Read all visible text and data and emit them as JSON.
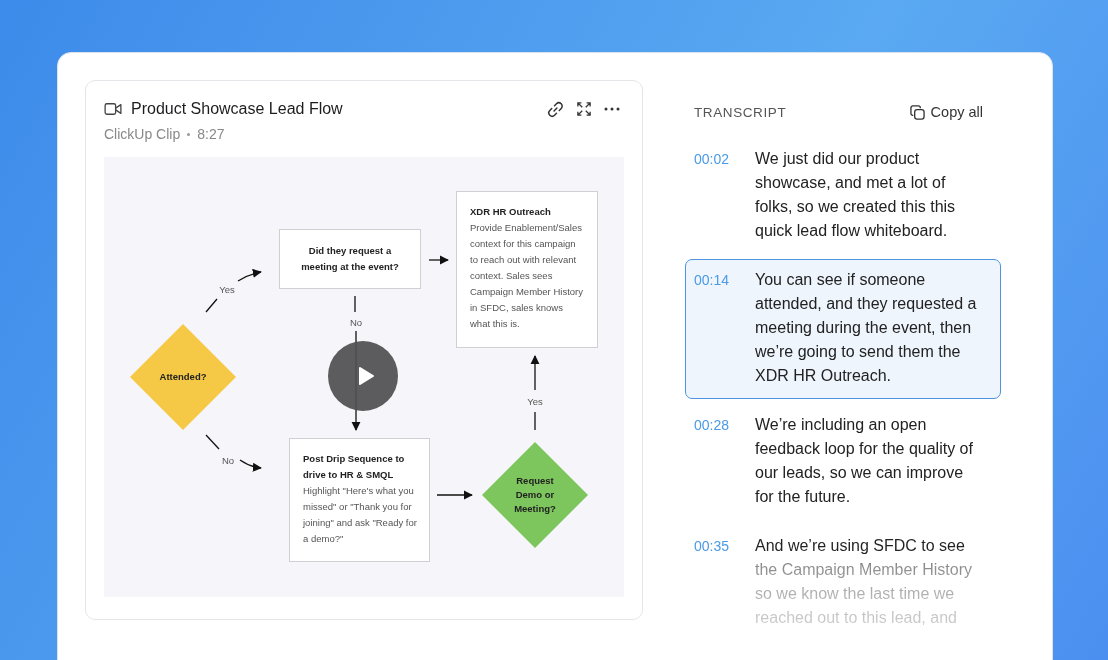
{
  "clip": {
    "title": "Product Showcase Lead Flow",
    "source": "ClickUp Clip",
    "duration": "8:27"
  },
  "flowchart": {
    "nodes": [
      {
        "kind": "decision",
        "label": "Attended?",
        "color": "#f5c945"
      },
      {
        "kind": "box",
        "title": "Did they request a meeting at the event?"
      },
      {
        "kind": "box",
        "title": "XDR HR Outreach",
        "body": "Provide Enablement/Sales context for this campaign to reach out with relevant context. Sales sees Campaign Member History in SFDC, sales knows what this is."
      },
      {
        "kind": "box",
        "title": "Post Drip Sequence to drive to HR & SMQL",
        "body": "Highlight \"Here's what you missed\" or \"Thank you for joining\" and ask \"Ready for a demo?\""
      },
      {
        "kind": "decision",
        "label": "Request Demo or Meeting?",
        "color": "#7dc55d"
      }
    ],
    "edge_labels": [
      "Yes",
      "No",
      "No",
      "Yes"
    ]
  },
  "transcript": {
    "heading": "TRANSCRIPT",
    "copy_label": "Copy all",
    "entries": [
      {
        "time": "00:02",
        "text": "We just did our product showcase, and met a lot of folks, so we created this this quick lead flow whiteboard.",
        "selected": false
      },
      {
        "time": "00:14",
        "text": "You can see if someone attended, and they requested a meeting during the event, then we’re going to send them the XDR HR Outreach.",
        "selected": true
      },
      {
        "time": "00:28",
        "text": "We’re including an open feedback loop for the quality of our leads, so we can improve for the future.",
        "selected": false
      },
      {
        "time": "00:35",
        "text": "And we’re using SFDC to see the Campaign Member History so we know the last time we reached out to this lead, and",
        "selected": false
      }
    ]
  }
}
